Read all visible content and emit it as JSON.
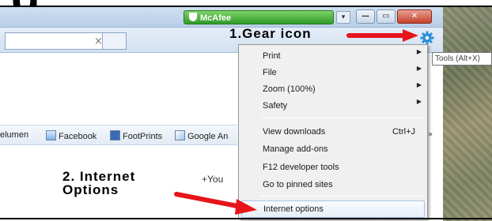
{
  "header": {
    "glyph": "g"
  },
  "titlebar": {
    "toolbar_name": "McAfee",
    "dropdown_icon": "chevron-down-icon",
    "min_icon": "minimize-icon",
    "max_icon": "maximize-icon",
    "close_icon": "close-icon"
  },
  "addressbar": {
    "close_glyph": "×"
  },
  "favorites": {
    "items": [
      {
        "label": "elumen",
        "icon": ""
      },
      {
        "label": "Facebook",
        "icon": "ie-page-icon"
      },
      {
        "label": "FootPrints",
        "icon": "footprints-icon"
      },
      {
        "label": "Google An",
        "icon": "chart-icon"
      }
    ],
    "overflow": "»"
  },
  "page": {
    "plus_you": "+You"
  },
  "annotations": {
    "step1": "1.Gear icon",
    "step2": "2. Internet Options"
  },
  "tooltip": {
    "text": "Tools (Alt+X)"
  },
  "tools_menu": {
    "items": [
      {
        "label": "Print",
        "submenu": true
      },
      {
        "label": "File",
        "submenu": true
      },
      {
        "label": "Zoom (100%)",
        "submenu": true
      },
      {
        "label": "Safety",
        "submenu": true
      },
      {
        "label": "View downloads",
        "shortcut": "Ctrl+J"
      },
      {
        "label": "Manage add-ons"
      },
      {
        "label": "F12 developer tools"
      },
      {
        "label": "Go to pinned sites"
      },
      {
        "label": "Internet options",
        "highlighted": true
      }
    ],
    "arrow_glyph": "▶"
  },
  "colors": {
    "annotation_arrow": "#e8141b",
    "mcafee_green": "#2f9a26",
    "gear_blue": "#2a8fd8"
  }
}
